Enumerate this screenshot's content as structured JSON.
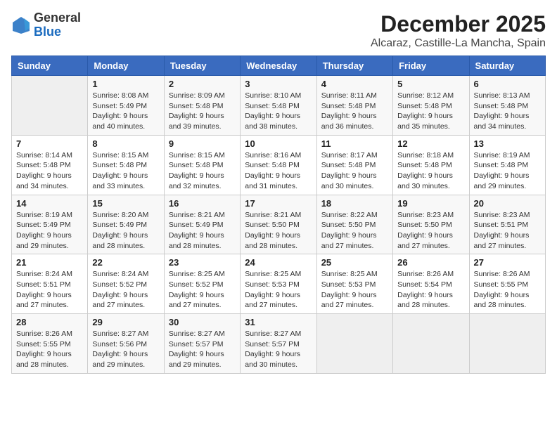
{
  "logo": {
    "general": "General",
    "blue": "Blue"
  },
  "title": "December 2025",
  "subtitle": "Alcaraz, Castille-La Mancha, Spain",
  "days_of_week": [
    "Sunday",
    "Monday",
    "Tuesday",
    "Wednesday",
    "Thursday",
    "Friday",
    "Saturday"
  ],
  "weeks": [
    [
      {
        "day": "",
        "sunrise": "",
        "sunset": "",
        "daylight": ""
      },
      {
        "day": "1",
        "sunrise": "Sunrise: 8:08 AM",
        "sunset": "Sunset: 5:49 PM",
        "daylight": "Daylight: 9 hours and 40 minutes."
      },
      {
        "day": "2",
        "sunrise": "Sunrise: 8:09 AM",
        "sunset": "Sunset: 5:48 PM",
        "daylight": "Daylight: 9 hours and 39 minutes."
      },
      {
        "day": "3",
        "sunrise": "Sunrise: 8:10 AM",
        "sunset": "Sunset: 5:48 PM",
        "daylight": "Daylight: 9 hours and 38 minutes."
      },
      {
        "day": "4",
        "sunrise": "Sunrise: 8:11 AM",
        "sunset": "Sunset: 5:48 PM",
        "daylight": "Daylight: 9 hours and 36 minutes."
      },
      {
        "day": "5",
        "sunrise": "Sunrise: 8:12 AM",
        "sunset": "Sunset: 5:48 PM",
        "daylight": "Daylight: 9 hours and 35 minutes."
      },
      {
        "day": "6",
        "sunrise": "Sunrise: 8:13 AM",
        "sunset": "Sunset: 5:48 PM",
        "daylight": "Daylight: 9 hours and 34 minutes."
      }
    ],
    [
      {
        "day": "7",
        "sunrise": "Sunrise: 8:14 AM",
        "sunset": "Sunset: 5:48 PM",
        "daylight": "Daylight: 9 hours and 34 minutes."
      },
      {
        "day": "8",
        "sunrise": "Sunrise: 8:15 AM",
        "sunset": "Sunset: 5:48 PM",
        "daylight": "Daylight: 9 hours and 33 minutes."
      },
      {
        "day": "9",
        "sunrise": "Sunrise: 8:15 AM",
        "sunset": "Sunset: 5:48 PM",
        "daylight": "Daylight: 9 hours and 32 minutes."
      },
      {
        "day": "10",
        "sunrise": "Sunrise: 8:16 AM",
        "sunset": "Sunset: 5:48 PM",
        "daylight": "Daylight: 9 hours and 31 minutes."
      },
      {
        "day": "11",
        "sunrise": "Sunrise: 8:17 AM",
        "sunset": "Sunset: 5:48 PM",
        "daylight": "Daylight: 9 hours and 30 minutes."
      },
      {
        "day": "12",
        "sunrise": "Sunrise: 8:18 AM",
        "sunset": "Sunset: 5:48 PM",
        "daylight": "Daylight: 9 hours and 30 minutes."
      },
      {
        "day": "13",
        "sunrise": "Sunrise: 8:19 AM",
        "sunset": "Sunset: 5:48 PM",
        "daylight": "Daylight: 9 hours and 29 minutes."
      }
    ],
    [
      {
        "day": "14",
        "sunrise": "Sunrise: 8:19 AM",
        "sunset": "Sunset: 5:49 PM",
        "daylight": "Daylight: 9 hours and 29 minutes."
      },
      {
        "day": "15",
        "sunrise": "Sunrise: 8:20 AM",
        "sunset": "Sunset: 5:49 PM",
        "daylight": "Daylight: 9 hours and 28 minutes."
      },
      {
        "day": "16",
        "sunrise": "Sunrise: 8:21 AM",
        "sunset": "Sunset: 5:49 PM",
        "daylight": "Daylight: 9 hours and 28 minutes."
      },
      {
        "day": "17",
        "sunrise": "Sunrise: 8:21 AM",
        "sunset": "Sunset: 5:50 PM",
        "daylight": "Daylight: 9 hours and 28 minutes."
      },
      {
        "day": "18",
        "sunrise": "Sunrise: 8:22 AM",
        "sunset": "Sunset: 5:50 PM",
        "daylight": "Daylight: 9 hours and 27 minutes."
      },
      {
        "day": "19",
        "sunrise": "Sunrise: 8:23 AM",
        "sunset": "Sunset: 5:50 PM",
        "daylight": "Daylight: 9 hours and 27 minutes."
      },
      {
        "day": "20",
        "sunrise": "Sunrise: 8:23 AM",
        "sunset": "Sunset: 5:51 PM",
        "daylight": "Daylight: 9 hours and 27 minutes."
      }
    ],
    [
      {
        "day": "21",
        "sunrise": "Sunrise: 8:24 AM",
        "sunset": "Sunset: 5:51 PM",
        "daylight": "Daylight: 9 hours and 27 minutes."
      },
      {
        "day": "22",
        "sunrise": "Sunrise: 8:24 AM",
        "sunset": "Sunset: 5:52 PM",
        "daylight": "Daylight: 9 hours and 27 minutes."
      },
      {
        "day": "23",
        "sunrise": "Sunrise: 8:25 AM",
        "sunset": "Sunset: 5:52 PM",
        "daylight": "Daylight: 9 hours and 27 minutes."
      },
      {
        "day": "24",
        "sunrise": "Sunrise: 8:25 AM",
        "sunset": "Sunset: 5:53 PM",
        "daylight": "Daylight: 9 hours and 27 minutes."
      },
      {
        "day": "25",
        "sunrise": "Sunrise: 8:25 AM",
        "sunset": "Sunset: 5:53 PM",
        "daylight": "Daylight: 9 hours and 27 minutes."
      },
      {
        "day": "26",
        "sunrise": "Sunrise: 8:26 AM",
        "sunset": "Sunset: 5:54 PM",
        "daylight": "Daylight: 9 hours and 28 minutes."
      },
      {
        "day": "27",
        "sunrise": "Sunrise: 8:26 AM",
        "sunset": "Sunset: 5:55 PM",
        "daylight": "Daylight: 9 hours and 28 minutes."
      }
    ],
    [
      {
        "day": "28",
        "sunrise": "Sunrise: 8:26 AM",
        "sunset": "Sunset: 5:55 PM",
        "daylight": "Daylight: 9 hours and 28 minutes."
      },
      {
        "day": "29",
        "sunrise": "Sunrise: 8:27 AM",
        "sunset": "Sunset: 5:56 PM",
        "daylight": "Daylight: 9 hours and 29 minutes."
      },
      {
        "day": "30",
        "sunrise": "Sunrise: 8:27 AM",
        "sunset": "Sunset: 5:57 PM",
        "daylight": "Daylight: 9 hours and 29 minutes."
      },
      {
        "day": "31",
        "sunrise": "Sunrise: 8:27 AM",
        "sunset": "Sunset: 5:57 PM",
        "daylight": "Daylight: 9 hours and 30 minutes."
      },
      {
        "day": "",
        "sunrise": "",
        "sunset": "",
        "daylight": ""
      },
      {
        "day": "",
        "sunrise": "",
        "sunset": "",
        "daylight": ""
      },
      {
        "day": "",
        "sunrise": "",
        "sunset": "",
        "daylight": ""
      }
    ]
  ]
}
